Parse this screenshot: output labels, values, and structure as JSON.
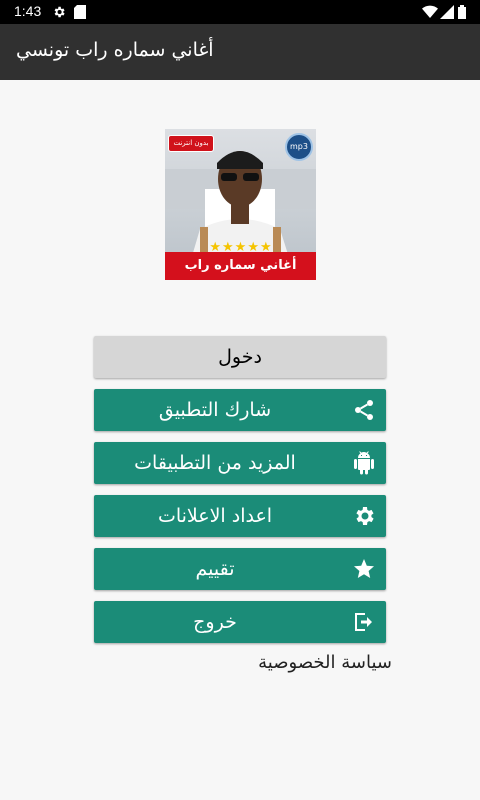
{
  "status_bar": {
    "time": "1:43"
  },
  "app_bar": {
    "title": "أغاني سماره راب تونسي"
  },
  "cover": {
    "badge_text": "بدون انترنت",
    "mp3_text": "mp3",
    "stars": "★★★★★",
    "banner_text": "أغاني سماره راب تونسي"
  },
  "buttons": {
    "login": "دخول",
    "share": "شارك التطبيق",
    "more_apps": "المزيد من التطبيقات",
    "ads_settings": "اعداد الاعلانات",
    "rate": "تقييم",
    "exit": "خروج"
  },
  "privacy_link": "سياسة الخصوصية",
  "colors": {
    "accent": "#1b8c78",
    "app_bar": "#303030",
    "login_button": "#d6d6d6"
  }
}
